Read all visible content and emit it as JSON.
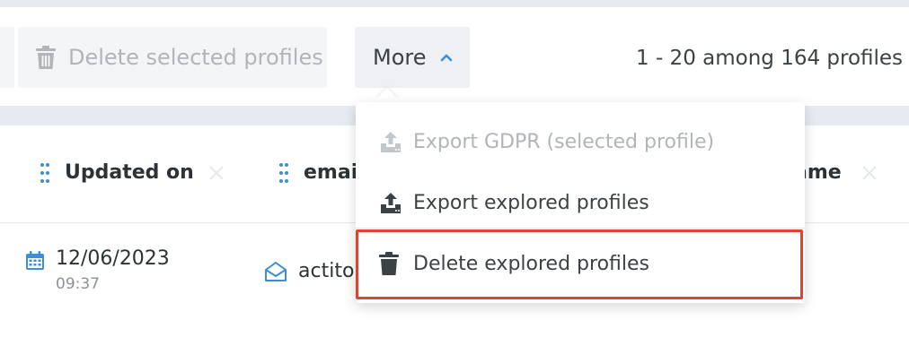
{
  "toolbar": {
    "delete_selected_label": "Delete selected profiles",
    "more_label": "More",
    "pagination_text": "1 - 20 among 164 profiles"
  },
  "columns": [
    {
      "label": "Updated on"
    },
    {
      "label": "emai"
    },
    {
      "label": "ame"
    }
  ],
  "row": {
    "date": "12/06/2023",
    "time": "09:37",
    "email": "actito"
  },
  "more_menu": {
    "items": [
      {
        "label": "Export GDPR (selected profile)",
        "icon": "upload-icon",
        "enabled": false
      },
      {
        "label": "Export explored profiles",
        "icon": "upload-icon",
        "enabled": true
      },
      {
        "label": "Delete explored profiles",
        "icon": "trash-icon",
        "enabled": true,
        "highlighted": true
      }
    ]
  },
  "colors": {
    "accent": "#3a8fd8",
    "highlight": "#e0442f",
    "disabled_text": "#b1b5ba",
    "text": "#3c4146",
    "band": "#e7ebf1"
  }
}
